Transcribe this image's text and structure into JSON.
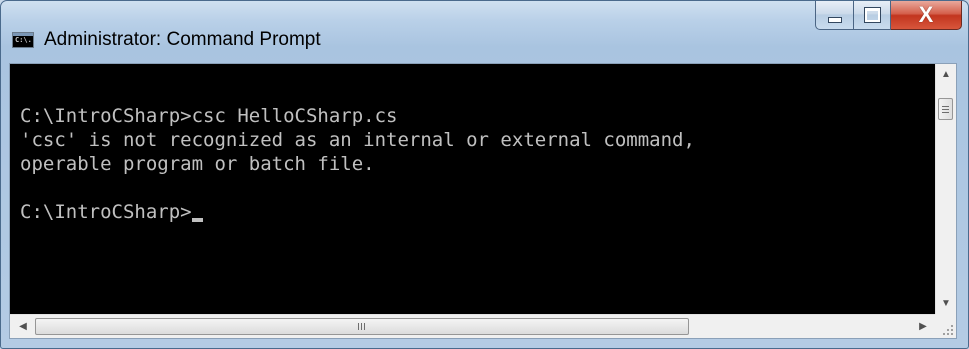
{
  "window": {
    "title": "Administrator: Command Prompt",
    "icon": "cmd-icon",
    "icon_text": "C:\\."
  },
  "caption": {
    "minimize_icon": "minimize-icon",
    "maximize_icon": "maximize-icon",
    "close_icon": "close-icon",
    "close_glyph": "X"
  },
  "console": {
    "lines": [
      "C:\\IntroCSharp>csc HelloCSharp.cs",
      "'csc' is not recognized as an internal or external command,",
      "operable program or batch file.",
      "",
      "C:\\IntroCSharp>"
    ],
    "text_color": "#c0c0c0",
    "background_color": "#000000"
  },
  "scrollbars": {
    "up_arrow": "▲",
    "down_arrow": "▼",
    "left_arrow": "◀",
    "right_arrow": "▶",
    "horizontal_grip": "|||"
  }
}
